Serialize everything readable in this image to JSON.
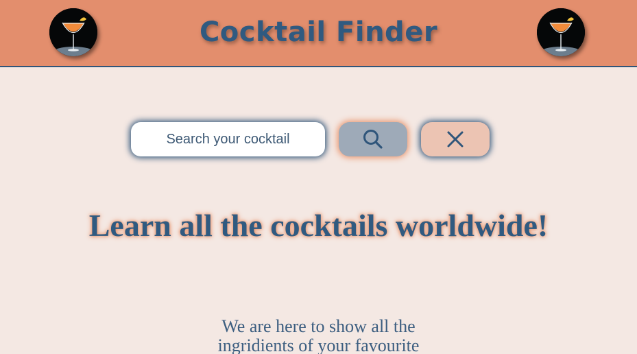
{
  "header": {
    "title": "Cocktail Finder",
    "logo_icon": "cocktail-glass-icon"
  },
  "search": {
    "placeholder": "Search your cocktail",
    "value": "",
    "search_icon": "search-icon",
    "clear_icon": "close-icon"
  },
  "hero": {
    "title": "Learn all the cocktails worldwide!",
    "text_line_1": "We are here to show all the",
    "text_line_2": "ingridients of your favourite"
  },
  "colors": {
    "header_bg": "#e38e6d",
    "page_bg": "#f4e8e3",
    "primary_text": "#305a80",
    "accent_glow": "#e9966f",
    "search_button_bg": "#9eaab8",
    "clear_button_bg": "#ecc4b3"
  }
}
